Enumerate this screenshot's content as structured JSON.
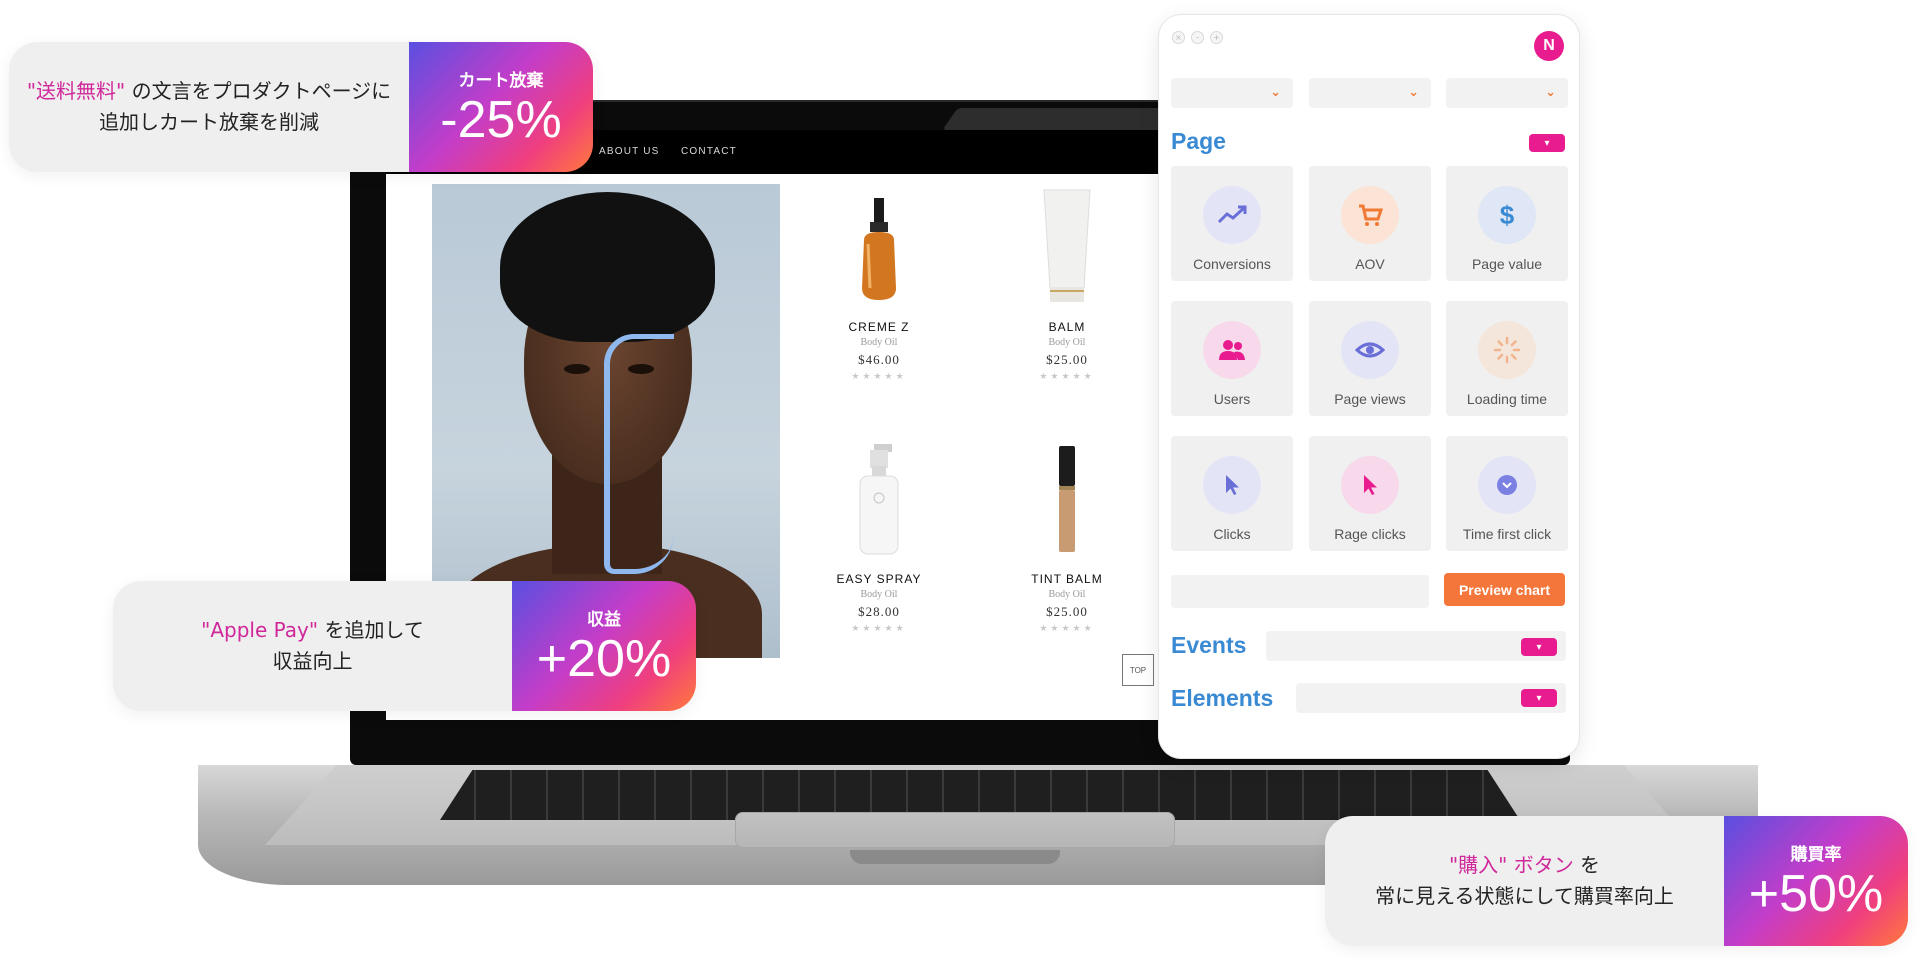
{
  "storefront": {
    "nav": [
      "ABOUT US",
      "CONTACT"
    ],
    "products": [
      {
        "name": "CREME Z",
        "sub": "Body Oil",
        "price": "$46.00",
        "stars": "★★★★★"
      },
      {
        "name": "BALM",
        "sub": "Body Oil",
        "price": "$25.00",
        "stars": "★★★★★"
      },
      {
        "name": "EASY SPRAY",
        "sub": "Body Oil",
        "price": "$28.00",
        "stars": "★★★★★"
      },
      {
        "name": "TINT BALM",
        "sub": "Body Oil",
        "price": "$25.00",
        "stars": "★★★★★"
      }
    ],
    "top_button": "TOP"
  },
  "panel": {
    "avatar_initial": "N",
    "page_section": {
      "title": "Page"
    },
    "metrics": [
      {
        "label": "Conversions",
        "icon": "trend-line-icon"
      },
      {
        "label": "AOV",
        "icon": "cart-icon"
      },
      {
        "label": "Page value",
        "icon": "dollar-icon"
      },
      {
        "label": "Users",
        "icon": "users-icon"
      },
      {
        "label": "Page views",
        "icon": "eye-icon"
      },
      {
        "label": "Loading time",
        "icon": "spinner-icon"
      },
      {
        "label": "Clicks",
        "icon": "cursor-icon"
      },
      {
        "label": "Rage clicks",
        "icon": "cursor-icon"
      },
      {
        "label": "Time first click",
        "icon": "chevron-circle-icon"
      }
    ],
    "preview_button": "Preview chart",
    "events_section": {
      "title": "Events"
    },
    "elements_section": {
      "title": "Elements"
    }
  },
  "callouts": [
    {
      "highlight": "\"送料無料\"",
      "line1_rest": " の文言をプロダクトページに",
      "line2": "追加しカート放棄を削減",
      "metric_label": "カート放棄",
      "metric_value": "-25%"
    },
    {
      "highlight": "\"Apple Pay\"",
      "line1_rest": " を追加して",
      "line2": "収益向上",
      "metric_label": "収益",
      "metric_value": "+20%"
    },
    {
      "highlight": "\"購入\" ボタン",
      "line1_rest": " を",
      "line2": "常に見える状態にして購買率向上",
      "metric_label": "購買率",
      "metric_value": "+50%"
    }
  ],
  "colors": {
    "accent_pink": "#e81c8f",
    "accent_orange": "#f5763a",
    "section_blue": "#3a8ad3",
    "highlight_magenta": "#d0279a"
  }
}
